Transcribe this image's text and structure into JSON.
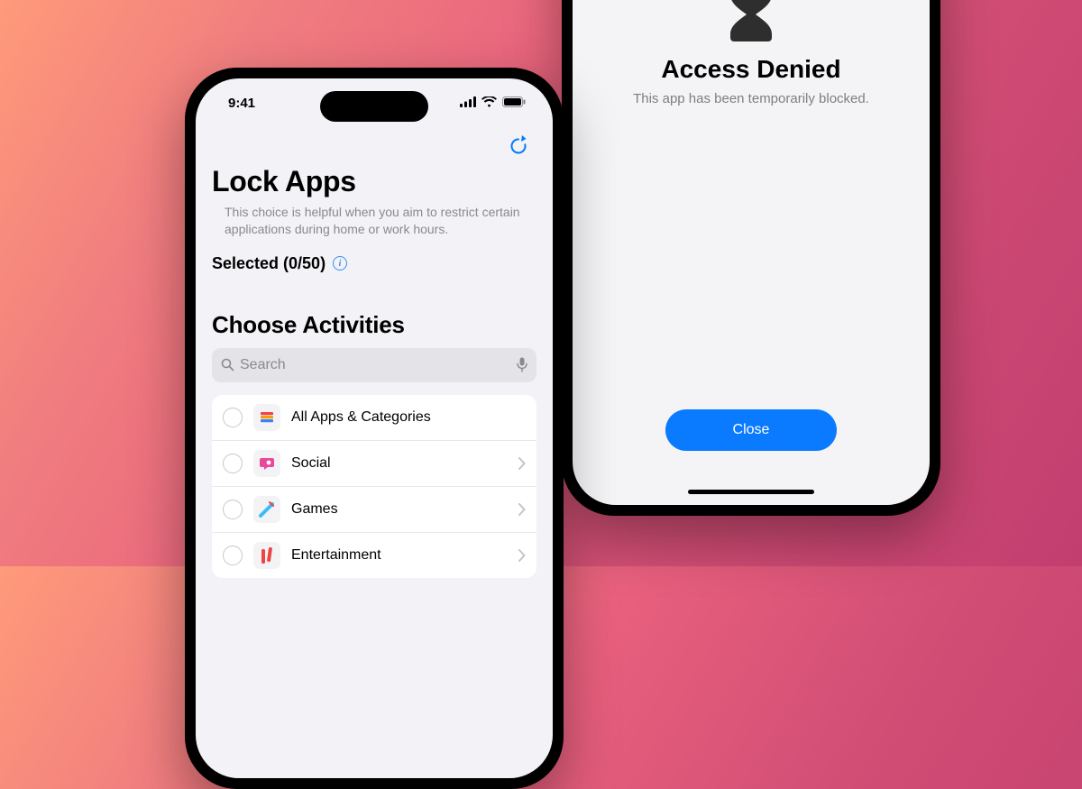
{
  "statusbar": {
    "time": "9:41"
  },
  "phone1": {
    "title": "Lock Apps",
    "subtitle": "This choice is helpful when you aim to restrict certain applications during home or work hours.",
    "selected_label": "Selected (0/50)",
    "section_title": "Choose Activities",
    "search": {
      "placeholder": "Search"
    },
    "items": [
      {
        "label": "All Apps & Categories"
      },
      {
        "label": "Social"
      },
      {
        "label": "Games"
      },
      {
        "label": "Entertainment"
      }
    ]
  },
  "phone2": {
    "title": "Access Denied",
    "subtitle": "This app has been temporarily blocked.",
    "close_label": "Close"
  }
}
